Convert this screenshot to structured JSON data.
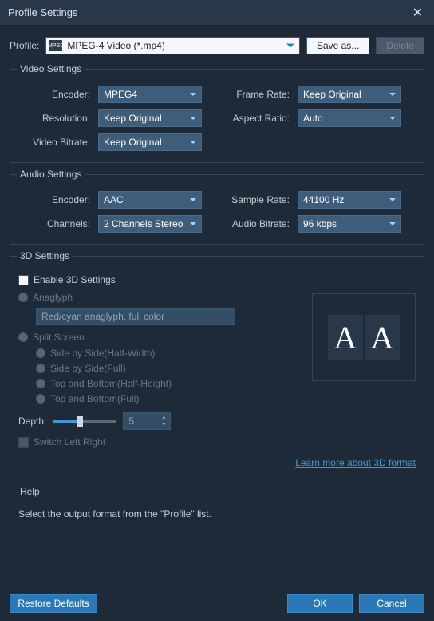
{
  "window": {
    "title": "Profile Settings"
  },
  "profile": {
    "label": "Profile:",
    "value": "MPEG-4 Video (*.mp4)",
    "save_as": "Save as...",
    "delete": "Delete"
  },
  "video": {
    "legend": "Video Settings",
    "encoder_label": "Encoder:",
    "encoder": "MPEG4",
    "framerate_label": "Frame Rate:",
    "framerate": "Keep Original",
    "resolution_label": "Resolution:",
    "resolution": "Keep Original",
    "aspectratio_label": "Aspect Ratio:",
    "aspectratio": "Auto",
    "bitrate_label": "Video Bitrate:",
    "bitrate": "Keep Original"
  },
  "audio": {
    "legend": "Audio Settings",
    "encoder_label": "Encoder:",
    "encoder": "AAC",
    "samplerate_label": "Sample Rate:",
    "samplerate": "44100 Hz",
    "channels_label": "Channels:",
    "channels": "2 Channels Stereo",
    "bitrate_label": "Audio Bitrate:",
    "bitrate": "96 kbps"
  },
  "threed": {
    "legend": "3D Settings",
    "enable": "Enable 3D Settings",
    "anaglyph": "Anaglyph",
    "anaglyph_mode": "Red/cyan anaglyph, full color",
    "splitscreen": "Split Screen",
    "sbs_half": "Side by Side(Half-Width)",
    "sbs_full": "Side by Side(Full)",
    "tab_half": "Top and Bottom(Half-Height)",
    "tab_full": "Top and Bottom(Full)",
    "depth_label": "Depth:",
    "depth_value": "5",
    "switch": "Switch Left Right",
    "preview_a": "A",
    "learn_more": "Learn more about 3D format"
  },
  "help": {
    "legend": "Help",
    "text": "Select the output format from the \"Profile\" list."
  },
  "footer": {
    "restore": "Restore Defaults",
    "ok": "OK",
    "cancel": "Cancel"
  }
}
